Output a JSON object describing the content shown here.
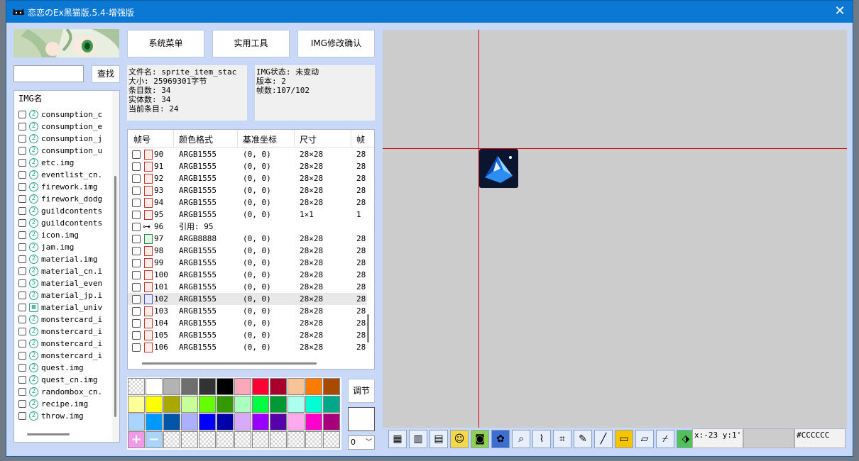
{
  "window": {
    "title": "恋恋のEx黑猫版.5.4-增强版",
    "close_glyph": "✕"
  },
  "search": {
    "value": "",
    "button": "查找"
  },
  "img_list": {
    "header": "IMG名",
    "items": [
      {
        "name": "consumption_c",
        "icon": "2"
      },
      {
        "name": "consumption_e",
        "icon": "2"
      },
      {
        "name": "consumption_j",
        "icon": "2"
      },
      {
        "name": "consumption_u",
        "icon": "2"
      },
      {
        "name": "etc.img",
        "icon": "2"
      },
      {
        "name": "eventlist_cn.",
        "icon": "2"
      },
      {
        "name": "firework.img",
        "icon": "2"
      },
      {
        "name": "firework_dodg",
        "icon": "2"
      },
      {
        "name": "guildcontents",
        "icon": "2"
      },
      {
        "name": "guildcontents",
        "icon": "2"
      },
      {
        "name": "icon.img",
        "icon": "2"
      },
      {
        "name": "jam.img",
        "icon": "2"
      },
      {
        "name": "material.img",
        "icon": "2"
      },
      {
        "name": "material_cn.i",
        "icon": "2"
      },
      {
        "name": "material_even",
        "icon": "5"
      },
      {
        "name": "material_jp.i",
        "icon": "2"
      },
      {
        "name": "material_univ",
        "icon": "grid"
      },
      {
        "name": "monstercard_i",
        "icon": "2"
      },
      {
        "name": "monstercard_i",
        "icon": "2"
      },
      {
        "name": "monstercard_i",
        "icon": "2"
      },
      {
        "name": "monstercard_i",
        "icon": "2"
      },
      {
        "name": "quest.img",
        "icon": "2"
      },
      {
        "name": "quest_cn.img",
        "icon": "2"
      },
      {
        "name": "randombox_cn.",
        "icon": "2"
      },
      {
        "name": "recipe.img",
        "icon": "2"
      },
      {
        "name": "throw.img",
        "icon": "2"
      }
    ]
  },
  "top_buttons": {
    "system_menu": "系统菜单",
    "tools": "实用工具",
    "img_confirm": "IMG修改确认"
  },
  "file_info": {
    "filename": "文件名: sprite_item_stac",
    "size": "大小: 25969301字节",
    "entries": "条目数: 34",
    "entities": "实体数: 34",
    "current": "当前条目: 24"
  },
  "img_info": {
    "status": "IMG状态: 未变动",
    "version": "版本: 2",
    "frames": "帧数:107/102"
  },
  "frame_table": {
    "columns": [
      "帧号",
      "颜色格式",
      "基准坐标",
      "尺寸",
      "帧"
    ],
    "rows": [
      {
        "num": "90",
        "icon": "r",
        "format": "ARGB1555",
        "base": "(0, 0)",
        "size": "28×28",
        "extra": "28"
      },
      {
        "num": "91",
        "icon": "r",
        "format": "ARGB1555",
        "base": "(0, 0)",
        "size": "28×28",
        "extra": "28"
      },
      {
        "num": "92",
        "icon": "r",
        "format": "ARGB1555",
        "base": "(0, 0)",
        "size": "28×28",
        "extra": "28"
      },
      {
        "num": "93",
        "icon": "r",
        "format": "ARGB1555",
        "base": "(0, 0)",
        "size": "28×28",
        "extra": "28"
      },
      {
        "num": "94",
        "icon": "r",
        "format": "ARGB1555",
        "base": "(0, 0)",
        "size": "28×28",
        "extra": "28"
      },
      {
        "num": "95",
        "icon": "r",
        "format": "ARGB1555",
        "base": "(0, 0)",
        "size": "1×1",
        "extra": "1"
      },
      {
        "num": "96",
        "icon": "link",
        "format": "引用: 95",
        "base": "",
        "size": "",
        "extra": ""
      },
      {
        "num": "97",
        "icon": "g",
        "format": "ARGB8888",
        "base": "(0, 0)",
        "size": "28×28",
        "extra": "28"
      },
      {
        "num": "98",
        "icon": "r",
        "format": "ARGB1555",
        "base": "(0, 0)",
        "size": "28×28",
        "extra": "28"
      },
      {
        "num": "99",
        "icon": "r",
        "format": "ARGB1555",
        "base": "(0, 0)",
        "size": "28×28",
        "extra": "28"
      },
      {
        "num": "100",
        "icon": "r",
        "format": "ARGB1555",
        "base": "(0, 0)",
        "size": "28×28",
        "extra": "28"
      },
      {
        "num": "101",
        "icon": "r",
        "format": "ARGB1555",
        "base": "(0, 0)",
        "size": "28×28",
        "extra": "28"
      },
      {
        "num": "102",
        "icon": "b",
        "format": "ARGB1555",
        "base": "(0, 0)",
        "size": "28×28",
        "extra": "28",
        "selected": true
      },
      {
        "num": "103",
        "icon": "r",
        "format": "ARGB1555",
        "base": "(0, 0)",
        "size": "28×28",
        "extra": "28"
      },
      {
        "num": "104",
        "icon": "r",
        "format": "ARGB1555",
        "base": "(0, 0)",
        "size": "28×28",
        "extra": "28"
      },
      {
        "num": "105",
        "icon": "r",
        "format": "ARGB1555",
        "base": "(0, 0)",
        "size": "28×28",
        "extra": "28"
      },
      {
        "num": "106",
        "icon": "r",
        "format": "ARGB1555",
        "base": "(0, 0)",
        "size": "28×28",
        "extra": "28"
      }
    ]
  },
  "palette": {
    "colors": [
      "checker",
      "#ffffff",
      "#b3b3b3",
      "#6e6e6e",
      "#333333",
      "#000000",
      "#f8a8b8",
      "#ff0033",
      "#a8002a",
      "#f7c497",
      "#ff7a00",
      "#a84a00",
      "#ffff99",
      "#ffff00",
      "#a8a800",
      "#c9ff99",
      "#66ff00",
      "#339900",
      "#aaffbf",
      "#00ff40",
      "#009933",
      "#aaffee",
      "#00ffd5",
      "#00a88a",
      "#a8d4ff",
      "#0099ff",
      "#0055a8",
      "#aab0ff",
      "#0000ff",
      "#0000a8",
      "#d9aaff",
      "#9900ff",
      "#5500a8",
      "#ffaaee",
      "#ff00cc",
      "#a8007a",
      "add",
      "remove",
      "checker",
      "checker",
      "checker",
      "checker",
      "checker",
      "checker",
      "checker",
      "checker",
      "checker",
      "checker"
    ],
    "adjust_button": "调节",
    "current_color": "#ffffff",
    "index_select": "0"
  },
  "toolbar": {
    "tools": [
      "frame-grid-icon",
      "palette-icon",
      "filmstrip-icon",
      "cat-face-icon",
      "camera-icon",
      "paw-icon",
      "magnifier-icon",
      "chart-icon",
      "crop-icon",
      "pencil-icon",
      "line-icon",
      "rectangle-icon",
      "eraser-icon",
      "eyedropper-icon",
      "tag-icon"
    ],
    "coords": "x:-23  y:1'",
    "color_hex": "#CCCCCC"
  },
  "canvas": {
    "background": "#cccccc",
    "crosshair_color": "#cc0000"
  }
}
